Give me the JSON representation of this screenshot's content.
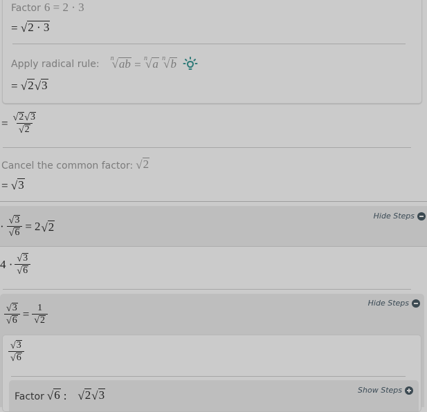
{
  "top_panel": {
    "step1_label": "Factor",
    "step1_expr": "6 = 2 · 3",
    "step1_result_eq": "=",
    "step1_result_arg": "2 · 3",
    "step2_label": "Apply radical rule:",
    "rule_lhs_index": "n",
    "rule_lhs_arg": "ab",
    "rule_eq": "=",
    "rule_rhs1_index": "n",
    "rule_rhs1_arg": "a",
    "rule_rhs2_index": "n",
    "rule_rhs2_arg": "b",
    "hint_icon": "lightbulb-icon",
    "step2_result_eq": "=",
    "step2_result_arg1": "2",
    "step2_result_arg2": "3"
  },
  "middle": {
    "frac_eq": "=",
    "frac_num_arg1": "2",
    "frac_num_arg2": "3",
    "frac_den_arg": "2",
    "cancel_label": "Cancel the common factor:",
    "cancel_arg": "2",
    "cancel_result_eq": "=",
    "cancel_result_arg": "3"
  },
  "section1": {
    "lead": "·",
    "num_arg": "3",
    "den_arg": "6",
    "eq": "=",
    "rhs_coef": "2",
    "rhs_arg": "2",
    "hide_steps_label": "Hide Steps",
    "hide_icon": "minus-circle-icon"
  },
  "section1_body": {
    "lead": "4 ·",
    "num_arg": "3",
    "den_arg": "6"
  },
  "section2": {
    "num_arg": "3",
    "den_arg": "6",
    "eq": "=",
    "rhs_num": "1",
    "rhs_den_arg": "2",
    "hide_steps_label": "Hide Steps",
    "hide_icon": "minus-circle-icon"
  },
  "section2_body": {
    "num_arg": "3",
    "den_arg": "6",
    "factor_label": "Factor",
    "factor_arg": "6",
    "factor_colon": ":",
    "factor_res_arg1": "2",
    "factor_res_arg2": "3",
    "show_steps_label": "Show Steps",
    "show_icon": "plus-circle-icon"
  },
  "colors": {
    "background": "#cbcbcb",
    "section_header_bg": "#bebebe",
    "accent_teal": "#2e7a78",
    "icon_dark": "#3c4a52"
  }
}
